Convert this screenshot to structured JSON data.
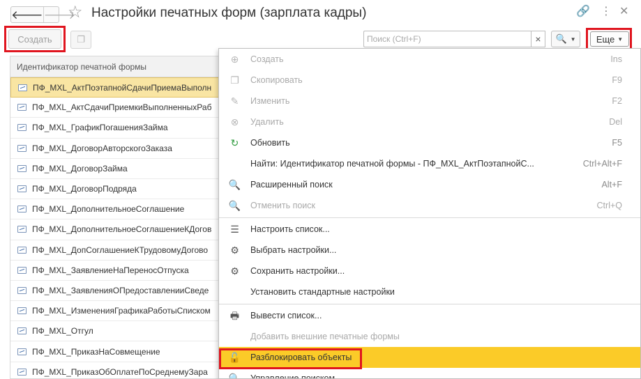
{
  "window": {
    "title": "Настройки печатных форм (зарплата кадры)",
    "back_glyph": "🡐",
    "forward_glyph": "🡒",
    "star_glyph": "☆",
    "link_glyph": "🔗",
    "more_glyph": "⋮",
    "close_glyph": "✕"
  },
  "toolbar": {
    "create_label": "Создать",
    "copy_glyph": "❐",
    "search_placeholder": "Поиск (Ctrl+F)",
    "clear_glyph": "×",
    "search_glyph": "🔍",
    "caret_glyph": "▼",
    "more_label": "Еще"
  },
  "table": {
    "header": "Идентификатор печатной формы",
    "rows": [
      "ПФ_MXL_АктПоэтапнойСдачиПриемаВыполн",
      "ПФ_MXL_АктСдачиПриемкиВыполненныхРаб",
      "ПФ_MXL_ГрафикПогашенияЗайма",
      "ПФ_MXL_ДоговорАвторскогоЗаказа",
      "ПФ_MXL_ДоговорЗайма",
      "ПФ_MXL_ДоговорПодряда",
      "ПФ_MXL_ДополнительноеСоглашение",
      "ПФ_MXL_ДополнительноеСоглашениеКДогов",
      "ПФ_MXL_ДопСоглашениеКТрудовомуДогово",
      "ПФ_MXL_ЗаявлениеНаПереносОтпуска",
      "ПФ_MXL_ЗаявленияОПредоставленииСведе",
      "ПФ_MXL_ИзмененияГрафикаРаботыСписком",
      "ПФ_MXL_Отгул",
      "ПФ_MXL_ПриказНаСовмещение",
      "ПФ_MXL_ПриказОбОплатеПоСреднемуЗара"
    ]
  },
  "menu": {
    "items": [
      {
        "label": "Создать",
        "shortcut": "Ins",
        "glyph": "⊕"
      },
      {
        "label": "Скопировать",
        "shortcut": "F9",
        "glyph": "❐"
      },
      {
        "label": "Изменить",
        "shortcut": "F2",
        "glyph": "✎"
      },
      {
        "label": "Удалить",
        "shortcut": "Del",
        "glyph": "⊗"
      },
      {
        "label": "Обновить",
        "shortcut": "F5",
        "glyph": "↻"
      },
      {
        "label": "Найти: Идентификатор печатной формы - ПФ_MXL_АктПоэтапнойС...",
        "shortcut": "Ctrl+Alt+F",
        "glyph": ""
      },
      {
        "label": "Расширенный поиск",
        "shortcut": "Alt+F",
        "glyph": "🔍"
      },
      {
        "label": "Отменить поиск",
        "shortcut": "Ctrl+Q",
        "glyph": "🔍"
      },
      {
        "label": "Настроить список...",
        "shortcut": "",
        "glyph": "☰"
      },
      {
        "label": "Выбрать настройки...",
        "shortcut": "",
        "glyph": "⚙"
      },
      {
        "label": "Сохранить настройки...",
        "shortcut": "",
        "glyph": "⚙"
      },
      {
        "label": "Установить стандартные настройки",
        "shortcut": "",
        "glyph": ""
      },
      {
        "label": "Вывести список...",
        "shortcut": "",
        "glyph": "🖶"
      },
      {
        "label": "Добавить внешние печатные формы",
        "shortcut": "",
        "glyph": ""
      },
      {
        "label": "Разблокировать объекты",
        "shortcut": "",
        "glyph": "🔓"
      },
      {
        "label": "Управление поиском",
        "shortcut": "",
        "glyph": "🔍"
      }
    ]
  }
}
